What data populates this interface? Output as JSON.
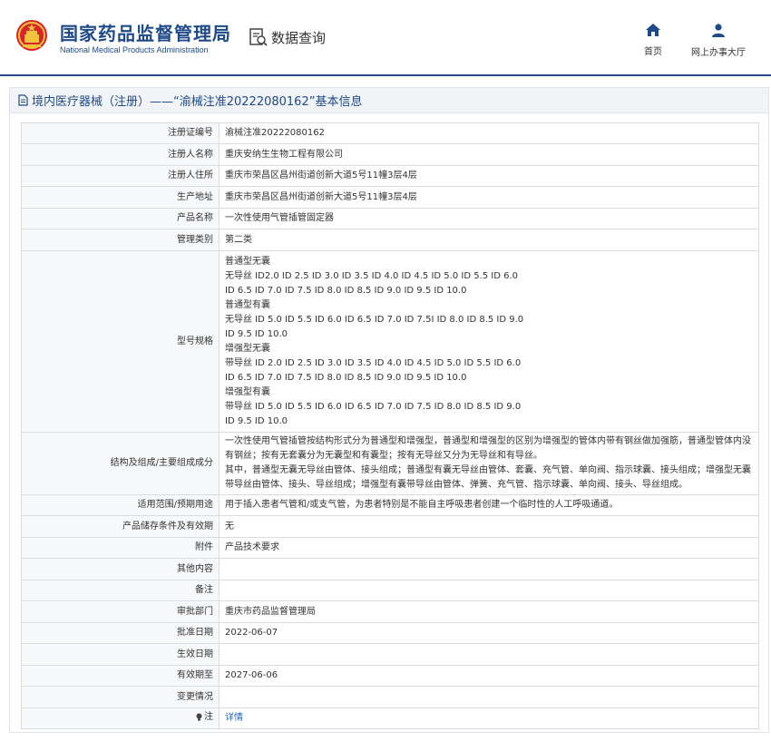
{
  "header": {
    "site_name_cn": "国家药品监督管理局",
    "site_name_en": "National Medical Products Administration",
    "query_label": "数据查询",
    "nav": [
      {
        "label": "首页",
        "icon": "home-icon"
      },
      {
        "label": "网上办事大厅",
        "icon": "user-icon"
      }
    ]
  },
  "card": {
    "title": "境内医疗器械（注册）——“渝械注准20222080162”基本信息"
  },
  "rows": {
    "reg_no": {
      "label": "注册证编号",
      "value": "渝械注准20222080162"
    },
    "registrant": {
      "label": "注册人名称",
      "value": "重庆安纳生生物工程有限公司"
    },
    "registrant_addr": {
      "label": "注册人住所",
      "value": "重庆市荣昌区昌州街道创新大道5号11幢3层4层"
    },
    "production_addr": {
      "label": "生产地址",
      "value": "重庆市荣昌区昌州街道创新大道5号11幢3层4层"
    },
    "product_name": {
      "label": "产品名称",
      "value": "一次性使用气管插管固定器"
    },
    "mgmt_class": {
      "label": "管理类别",
      "value": "第二类"
    },
    "spec": {
      "label": "型号规格",
      "lines": [
        "普通型无囊",
        "无导丝 ID2.0 ID 2.5 ID 3.0 ID 3.5 ID 4.0 ID 4.5 ID 5.0 ID 5.5 ID 6.0",
        "ID 6.5 ID 7.0 ID 7.5 ID 8.0 ID 8.5 ID 9.0 ID 9.5 ID 10.0",
        "普通型有囊",
        "无导丝 ID 5.0 ID 5.5 ID 6.0 ID 6.5 ID 7.0 ID 7.5I ID 8.0 ID 8.5 ID 9.0",
        "ID 9.5 ID 10.0",
        "增强型无囊",
        "带导丝 ID 2.0 ID 2.5 ID 3.0 ID 3.5 ID 4.0 ID 4.5 ID 5.0 ID 5.5 ID 6.0",
        "ID 6.5 ID 7.0 ID 7.5 ID 8.0 ID 8.5 ID 9.0 ID 9.5 ID 10.0",
        "增强型有囊",
        "带导丝 ID 5.0 ID 5.5 ID 6.0 ID 6.5 ID 7.0 ID 7.5 ID 8.0 ID 8.5 ID 9.0",
        "ID 9.5 ID 10.0"
      ]
    },
    "structure": {
      "label": "结构及组成/主要组成成分",
      "lines": [
        "一次性使用气管插管按结构形式分为普通型和增强型，普通型和增强型的区别为增强型的管体内带有钢丝做加强筋，普通型管体内没",
        "有钢丝；按有无套囊分为无囊型和有囊型；按有无导丝又分为无导丝和有导丝。",
        "其中，普通型无囊无导丝由管体、接头组成；普通型有囊无导丝由管体、套囊、充气管、单向阀、指示球囊、接头组成；增强型无囊",
        "带导丝由管体、接头、导丝组成；增强型有囊带导丝由管体、弹簧、充气管、指示球囊、单向阀、接头、导丝组成。"
      ]
    },
    "scope": {
      "label": "适用范围/预期用途",
      "value": "用于插入患者气管和/或支气管，为患者特别是不能自主呼吸患者创建一个临时性的人工呼吸通道。"
    },
    "storage": {
      "label": "产品储存条件及有效期",
      "value": "无"
    },
    "attachment": {
      "label": "附件",
      "value": "产品技术要求"
    },
    "other": {
      "label": "其他内容",
      "value": ""
    },
    "remark": {
      "label": "备注",
      "value": ""
    },
    "dept": {
      "label": "审批部门",
      "value": "重庆市药品监督管理局"
    },
    "approve_date": {
      "label": "批准日期",
      "value": "2022-06-07"
    },
    "produce_date": {
      "label": "生效日期",
      "value": ""
    },
    "expire_date": {
      "label": "有效期至",
      "value": "2027-06-06"
    },
    "change": {
      "label": "变更情况",
      "value": ""
    },
    "note": {
      "label": "注",
      "value": "详情"
    }
  }
}
